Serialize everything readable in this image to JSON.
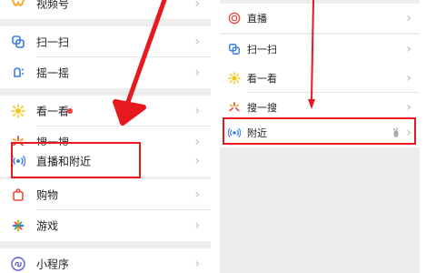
{
  "left_menu": {
    "items": [
      {
        "label": "视频号",
        "icon": "video-channel-icon"
      },
      {
        "label": "扫一扫",
        "icon": "scan-icon"
      },
      {
        "label": "摇一摇",
        "icon": "shake-icon"
      },
      {
        "label": "看一看",
        "icon": "top-stories-icon",
        "has_badge": true
      },
      {
        "label": "搜一搜",
        "icon": "search-icon"
      },
      {
        "label": "直播和附近",
        "icon": "live-nearby-icon"
      },
      {
        "label": "购物",
        "icon": "shopping-icon"
      },
      {
        "label": "游戏",
        "icon": "games-icon"
      },
      {
        "label": "小程序",
        "icon": "mini-programs-icon"
      }
    ]
  },
  "right_menu": {
    "items": [
      {
        "label": "直播",
        "icon": "live-icon"
      },
      {
        "label": "扫一扫",
        "icon": "scan-icon"
      },
      {
        "label": "看一看",
        "icon": "top-stories-icon"
      },
      {
        "label": "搜一搜",
        "icon": "search-icon"
      },
      {
        "label": "附近",
        "icon": "nearby-icon"
      }
    ]
  },
  "chevron": "›",
  "colors": {
    "highlight": "#e8191e",
    "badge": "#fa3c3c",
    "group_gap": "#ededed"
  }
}
